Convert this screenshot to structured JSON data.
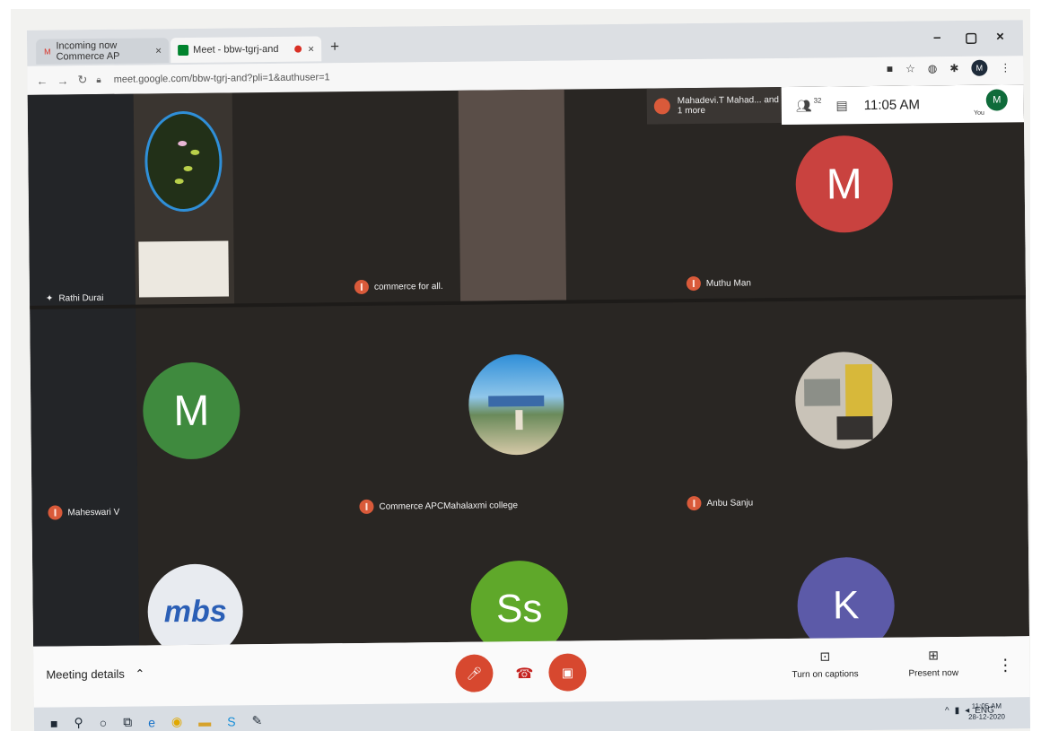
{
  "browser": {
    "tabs": [
      {
        "label": "Incoming now Commerce AP",
        "close": "×"
      },
      {
        "label": "Meet - bbw-tgrj-and",
        "close": "×"
      }
    ],
    "new_tab": "+",
    "window_controls": {
      "minimize": "–",
      "maximize": "▢",
      "close": "×"
    },
    "url": "meet.google.com/bbw-tgrj-and?pli=1&authuser=1",
    "profile_initial": "M"
  },
  "meet": {
    "top_tile_label": "Mahadevi.T Mahad... and 1 more",
    "participant_count": "32",
    "clock": "11:05 AM",
    "you_label": "You",
    "you_initial": "M",
    "participants": [
      {
        "name": "Rathi Durai"
      },
      {
        "name": "commerce for all."
      },
      {
        "name": "Muthu Man",
        "initial": "M",
        "color": "#c9423f"
      },
      {
        "name": "Maheswari V",
        "initial": "M",
        "color": "#3f8a3e"
      },
      {
        "name": "Commerce APCMahalaxmi college"
      },
      {
        "name": "Anbu Sanju"
      },
      {
        "name": "",
        "logo_text": "mbs"
      },
      {
        "name": "",
        "initial": "Ss",
        "color": "#5fa82a"
      },
      {
        "name": "",
        "initial": "K",
        "color": "#5c5aa8"
      }
    ]
  },
  "controls": {
    "meeting_details": "Meeting details",
    "captions": "Turn on captions",
    "present": "Present now"
  },
  "taskbar": {
    "time": "11:05 AM",
    "date": "28-12-2020",
    "lang": "ENG"
  }
}
